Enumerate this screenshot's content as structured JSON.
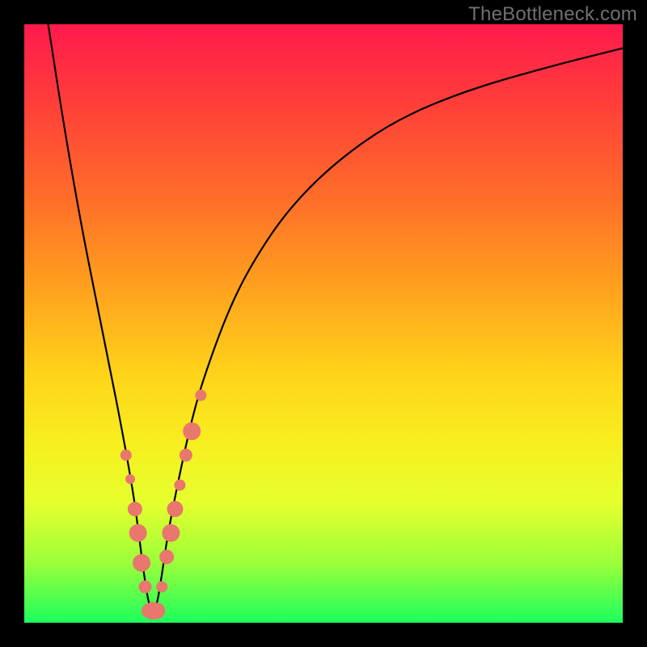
{
  "watermark": "TheBottleneck.com",
  "colors": {
    "frame_bg": "#000000",
    "gradient_top": "#ff1a4d",
    "gradient_bottom": "#1cff5e",
    "curve": "#000000",
    "marker": "#e8776d"
  },
  "chart_data": {
    "type": "line",
    "title": "",
    "xlabel": "",
    "ylabel": "",
    "xlim": [
      0,
      100
    ],
    "ylim": [
      0,
      100
    ],
    "series": [
      {
        "name": "curve",
        "x": [
          4,
          6,
          8,
          10,
          12,
          14,
          16,
          18,
          19,
          20,
          21,
          22,
          23,
          24,
          26,
          28,
          30,
          34,
          38,
          44,
          52,
          62,
          74,
          88,
          100
        ],
        "y": [
          100,
          87,
          75,
          64,
          54,
          44,
          34,
          23,
          16,
          8,
          2,
          2,
          8,
          15,
          25,
          34,
          41,
          52,
          60,
          69,
          77,
          84,
          89,
          93,
          96
        ]
      }
    ],
    "markers": {
      "name": "highlight-points",
      "x": [
        17.0,
        17.7,
        18.5,
        19.0,
        19.6,
        20.2,
        20.8,
        21.5,
        22.2,
        23.0,
        23.8,
        24.5,
        25.2,
        26.0,
        27.0,
        28.0,
        29.5
      ],
      "y": [
        28,
        24,
        19,
        15,
        10,
        6,
        2,
        2,
        2,
        6,
        11,
        15,
        19,
        23,
        28,
        32,
        38
      ],
      "r": [
        7,
        6,
        9,
        11,
        11,
        8,
        9,
        11,
        10,
        7,
        9,
        11,
        10,
        7,
        8,
        11,
        7
      ]
    }
  }
}
